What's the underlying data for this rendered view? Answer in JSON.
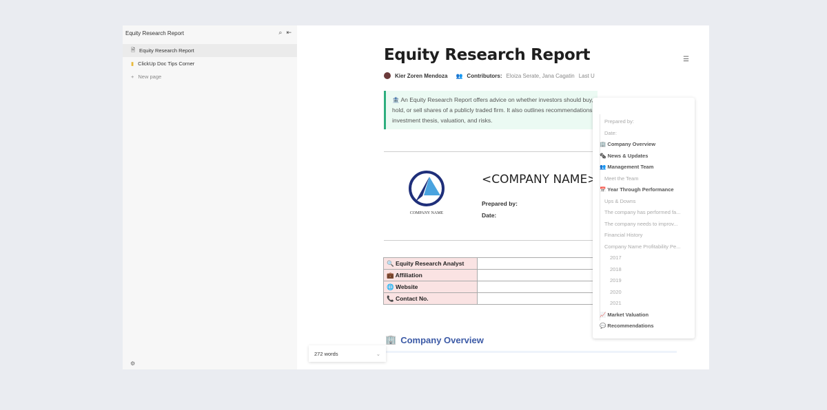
{
  "sidebar": {
    "title": "Equity Research Report",
    "items": [
      {
        "label": "Equity Research Report",
        "icon": "doc-icon"
      },
      {
        "label": "ClickUp Doc Tips Corner",
        "icon": "folder-icon"
      },
      {
        "label": "New page",
        "icon": "plus-icon"
      }
    ]
  },
  "doc": {
    "title": "Equity Research Report",
    "author": "Kier Zoren Mendoza",
    "contributors_label": "Contributors:",
    "contributors": "Eloiza Serate, Jana Cagatin",
    "last_updated": "Last U",
    "callout": "An Equity Research Report offers advice on whether investors should buy, hold, or sell shares of a publicly traded firm. It also outlines recommendations, investment thesis, valuation, and risks.",
    "logo_text": "COMPANY NAME",
    "company_name": "<COMPANY NAME>",
    "prepared_by": "Prepared by:",
    "date": "Date:",
    "table": [
      {
        "icon": "🔍",
        "label": "Equity Research Analyst"
      },
      {
        "icon": "💼",
        "label": "Affiliation"
      },
      {
        "icon": "🌐",
        "label": "Website"
      },
      {
        "icon": "📞",
        "label": "Contact No."
      }
    ],
    "section": "Company Overview",
    "section_icon": "🏢"
  },
  "word_count": "272 words",
  "toc": [
    {
      "label": "Prepared by:",
      "level": 2
    },
    {
      "label": "Date:",
      "level": 2
    },
    {
      "label": "🏢 Company Overview",
      "level": 1
    },
    {
      "label": "🗞 News & Updates",
      "level": 1
    },
    {
      "label": "👥 Management Team",
      "level": 1
    },
    {
      "label": "Meet the Team",
      "level": 2
    },
    {
      "label": "📅 Year Through Performance",
      "level": 1
    },
    {
      "label": "Ups & Downs",
      "level": 2
    },
    {
      "label": "The company has performed fa...",
      "level": 2
    },
    {
      "label": "The company needs to improv...",
      "level": 2
    },
    {
      "label": "Financial History",
      "level": 2
    },
    {
      "label": "Company Name Profitability Pe...",
      "level": 2
    },
    {
      "label": "2017",
      "level": 3
    },
    {
      "label": "2018",
      "level": 3
    },
    {
      "label": "2019",
      "level": 3
    },
    {
      "label": "2020",
      "level": 3
    },
    {
      "label": "2021",
      "level": 3
    },
    {
      "label": "📈 Market Valuation",
      "level": 1
    },
    {
      "label": "💬 Recommendations",
      "level": 1
    }
  ],
  "colors": {
    "callout_border": "#2cae7e",
    "section_heading": "#3c5aa6",
    "table_key_bg": "#fae3e3"
  }
}
